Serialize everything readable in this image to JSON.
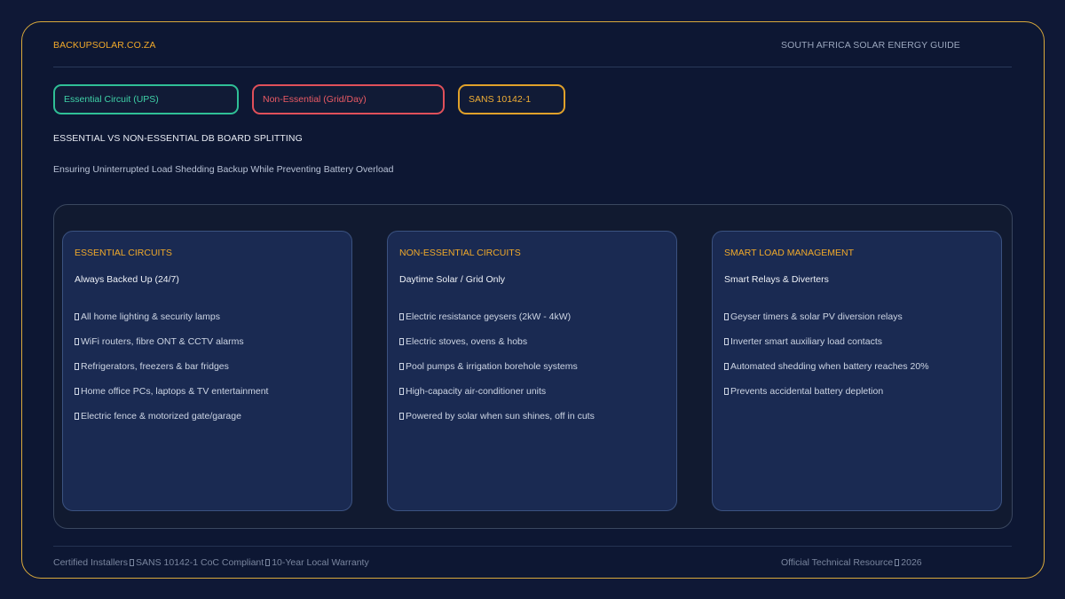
{
  "header": {
    "brand": "BACKUPSOLAR.CO.ZA",
    "guide": "SOUTH AFRICA SOLAR ENERGY GUIDE"
  },
  "tags": {
    "essential": "Essential Circuit (UPS)",
    "non_essential": "Non-Essential (Grid/Day)",
    "sans": "SANS 10142-1"
  },
  "main": {
    "title": "ESSENTIAL VS NON-ESSENTIAL DB BOARD SPLITTING",
    "subtitle": "Ensuring Uninterrupted Load Shedding Backup While Preventing Battery Overload"
  },
  "cards": [
    {
      "heading": "ESSENTIAL CIRCUITS",
      "subheading": "Always Backed Up (24/7)",
      "items": [
        "All home lighting & security lamps",
        "WiFi routers, fibre ONT & CCTV alarms",
        "Refrigerators, freezers & bar fridges",
        "Home office PCs, laptops & TV entertainment",
        "Electric fence & motorized gate/garage"
      ]
    },
    {
      "heading": "NON-ESSENTIAL CIRCUITS",
      "subheading": "Daytime Solar / Grid Only",
      "items": [
        "Electric resistance geysers (2kW - 4kW)",
        "Electric stoves, ovens & hobs",
        "Pool pumps & irrigation borehole systems",
        "High-capacity air-conditioner units",
        "Powered by solar when sun shines, off in cuts"
      ]
    },
    {
      "heading": "SMART LOAD MANAGEMENT",
      "subheading": "Smart Relays & Diverters",
      "items": [
        "Geyser timers & solar PV diversion relays",
        "Inverter smart auxiliary load contacts",
        "Automated shedding when battery reaches 20%",
        "Prevents accidental battery depletion"
      ]
    }
  ],
  "footer": {
    "left_parts": [
      "Certified Installers",
      "SANS 10142-1 CoC Compliant",
      "10-Year Local Warranty"
    ],
    "right_parts": [
      "Official Technical Resource",
      "2026"
    ]
  }
}
